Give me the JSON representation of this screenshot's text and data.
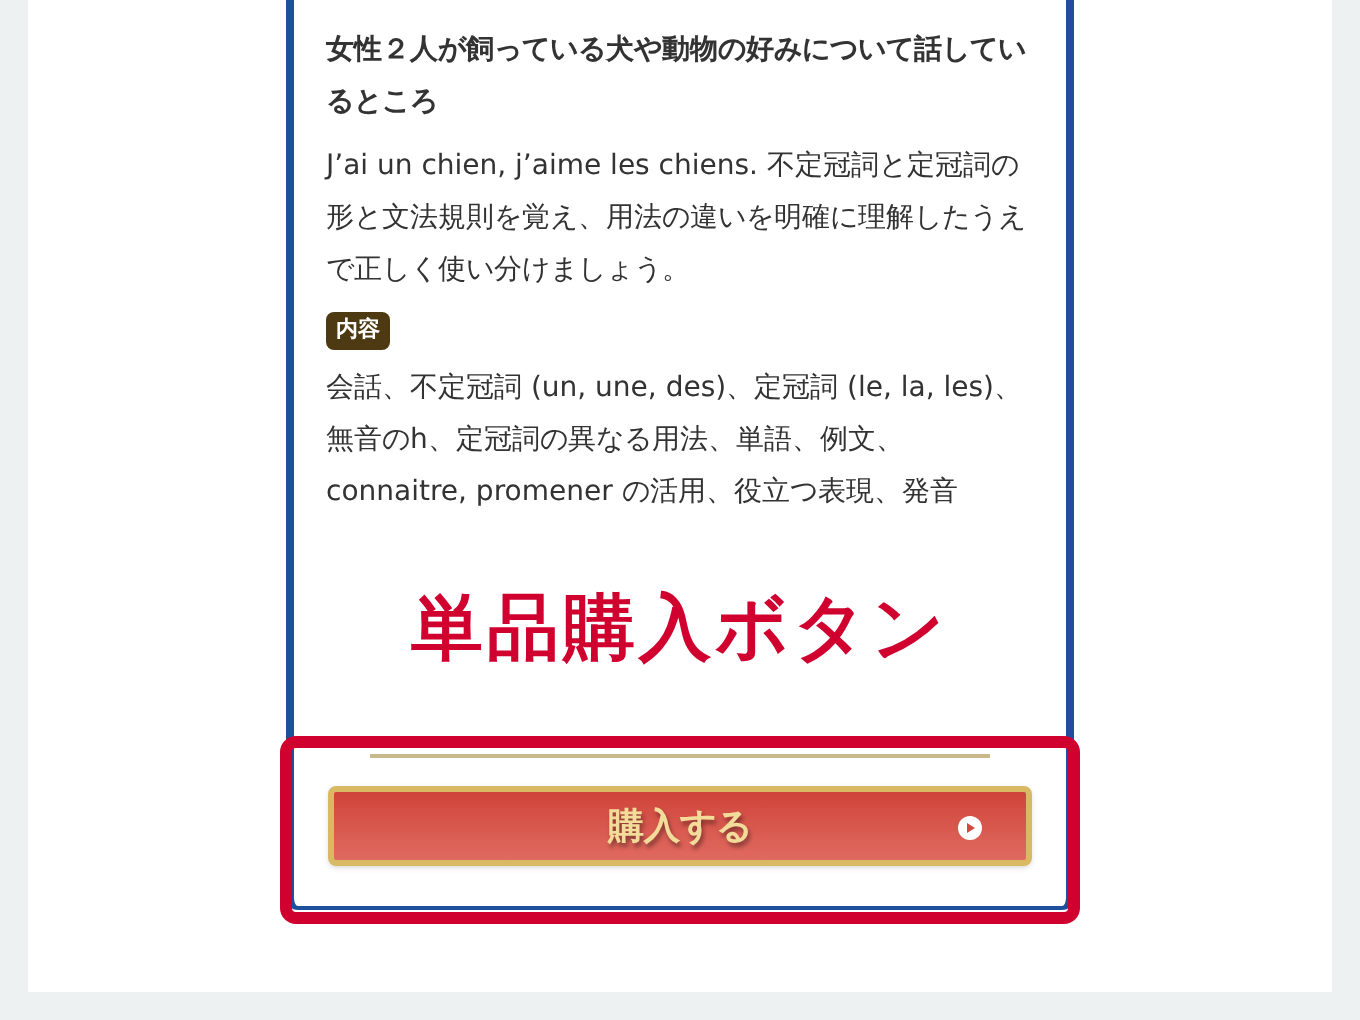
{
  "card": {
    "title": "女性２人が飼っている犬や動物の好みについて話しているところ",
    "description": "J’ai un chien, j’aime les chiens. 不定冠詞と定冠詞の形と文法規則を覚え、用法の違いを明確に理解したうえで正しく使い分けましょう。",
    "contents_badge": "内容",
    "contents": "会話、不定冠詞 (un, une, des)、定冠詞 (le, la, les)、無音のh、定冠詞の異なる用法、単語、例文、connaitre, promener の活用、役立つ表現、発音",
    "buy_button": "購入する"
  },
  "annotation": {
    "label": "単品購入ボタン"
  }
}
